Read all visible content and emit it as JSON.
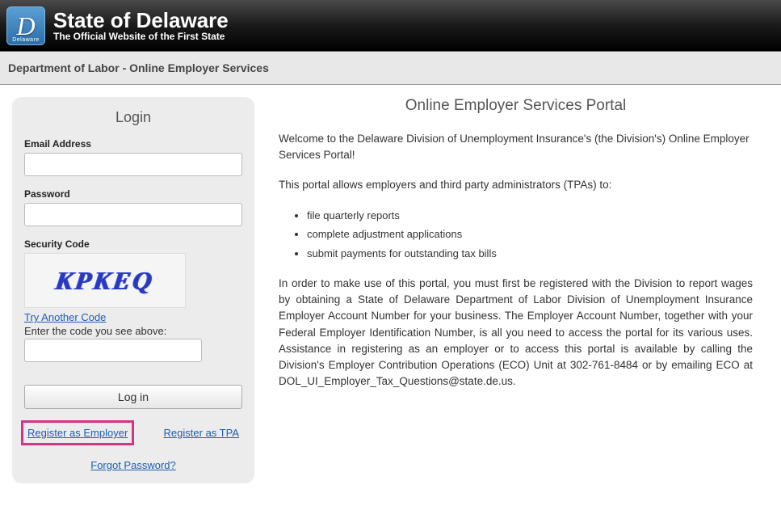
{
  "banner": {
    "logo_letter": "D",
    "logo_small": "Delaware",
    "title": "State of Delaware",
    "subtitle": "The Official Website of the First State"
  },
  "dept_bar": "Department of Labor - Online Employer Services",
  "login": {
    "title": "Login",
    "email_label": "Email Address",
    "password_label": "Password",
    "security_label": "Security Code",
    "captcha_text": "KPKEQ",
    "try_code": "Try Another Code",
    "enter_code": "Enter the code you see above:",
    "button": "Log in",
    "register_employer": "Register as Employer",
    "register_tpa": "Register as TPA",
    "forgot": "Forgot Password?"
  },
  "portal": {
    "title": "Online Employer Services Portal",
    "welcome": "Welcome to the Delaware Division of Unemployment Insurance's (the Division's) Online Employer Services Portal!",
    "allows": "This portal allows employers and third party administrators (TPAs) to:",
    "bullets": [
      "file quarterly reports",
      "complete adjustment applications",
      "submit payments for outstanding tax bills"
    ],
    "body": "In order to make use of this portal, you must first be registered with the Division to report wages by obtaining a State of Delaware Department of Labor Division of Unemployment Insurance Employer Account Number for your business. The Employer Account Number, together with your Federal Employer Identification Number, is all you need to access the portal for its various uses. Assistance in registering as an employer or to access this portal is available by calling the Division's Employer Contribution Operations (ECO) Unit at 302-761-8484 or by emailing ECO at DOL_UI_Employer_Tax_Questions@state.de.us."
  }
}
